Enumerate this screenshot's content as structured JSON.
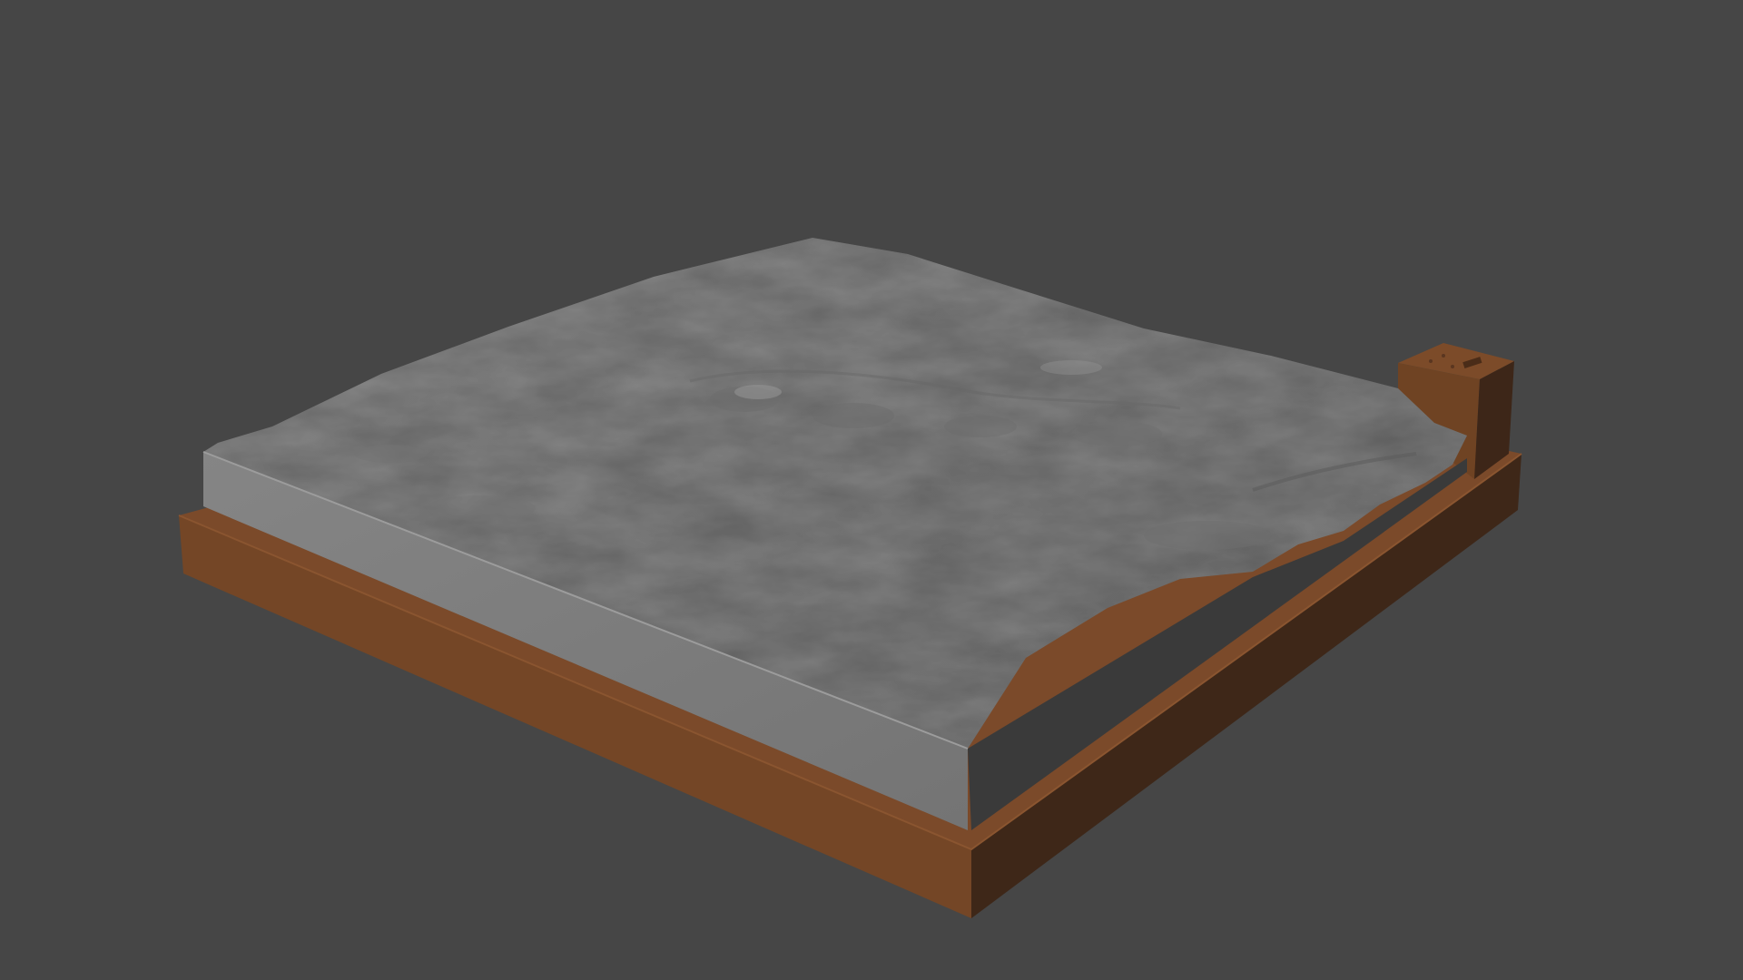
{
  "scene": {
    "background_color": "#464646",
    "objects": [
      {
        "name": "terrain-model",
        "top_color": "#808080",
        "front_color": "#7a7a7a",
        "right_color": "#3a3a3a"
      },
      {
        "name": "base-frame",
        "top_color": "#7b4a2a",
        "front_color": "#734626",
        "right_color": "#3d2618"
      },
      {
        "name": "corner-block",
        "top_color": "#7a4a28",
        "front_color": "#6f4323",
        "right_color": "#3d2618"
      }
    ]
  }
}
